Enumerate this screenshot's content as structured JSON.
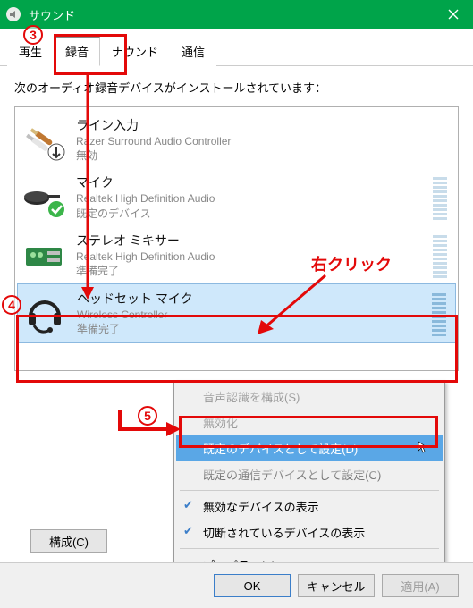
{
  "window": {
    "title": "サウンド"
  },
  "tabs": {
    "playback": "再生",
    "recording": "録音",
    "sounds": "ナウンド",
    "comm": "通信"
  },
  "intro": "次のオーディオ録音デバイスがインストールされています：",
  "devices": [
    {
      "name": "ライン入力",
      "sub1": "Razer Surround Audio Controller",
      "sub2": "無効"
    },
    {
      "name": "マイク",
      "sub1": "Realtek High Definition Audio",
      "sub2": "既定のデバイス"
    },
    {
      "name": "ステレオ ミキサー",
      "sub1": "Realtek High Definition Audio",
      "sub2": "準備完了"
    },
    {
      "name": "ヘッドセット マイク",
      "sub1": "Wireless Controller",
      "sub2": "準備完了"
    }
  ],
  "context": {
    "configure": "音声認識を構成(S)",
    "disable": "無効化",
    "setDefault": "既定のデバイスとして設定(D)",
    "setComm": "既定の通信デバイスとして設定(C)",
    "showDisabled": "無効なデバイスの表示",
    "showDisconnected": "切断されているデバイスの表示",
    "properties": "プロパティ(P)"
  },
  "buttons": {
    "configure": "構成(C)",
    "ok": "OK",
    "cancel": "キャンセル",
    "apply": "適用(A)"
  },
  "anno": {
    "rightClick": "右クリック",
    "n3": "3",
    "n4": "4",
    "n5": "5"
  }
}
